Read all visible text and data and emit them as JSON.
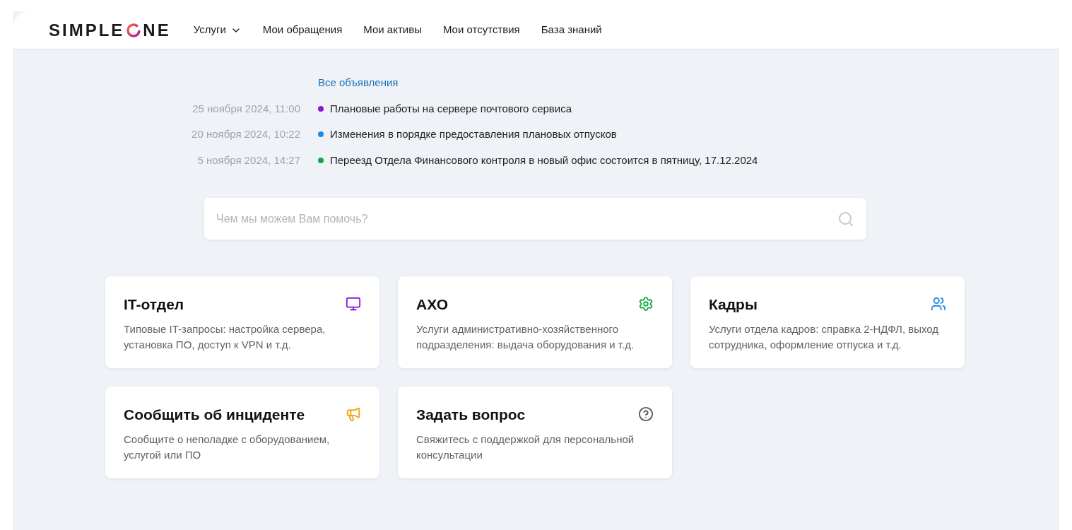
{
  "logo": {
    "left": "SIMPLE",
    "right": "NE"
  },
  "nav": [
    {
      "label": "Услуги",
      "dropdown": true
    },
    {
      "label": "Мои обращения",
      "dropdown": false
    },
    {
      "label": "Мои активы",
      "dropdown": false
    },
    {
      "label": "Мои отсутствия",
      "dropdown": false
    },
    {
      "label": "База знаний",
      "dropdown": false
    }
  ],
  "announcements": {
    "all_link": "Все объявления",
    "items": [
      {
        "date": "25 ноября 2024, 11:00",
        "title": "Плановые работы на сервере почтового сервиса",
        "color": "#8a16d8"
      },
      {
        "date": "20 ноября 2024, 10:22",
        "title": "Изменения в порядке предоставления плановых отпусков",
        "color": "#1e88e5"
      },
      {
        "date": "5 ноября 2024, 14:27",
        "title": "Переезд Отдела Финансового контроля в новый офис состоится в пятницу, 17.12.2024",
        "color": "#12a84a"
      }
    ]
  },
  "search": {
    "placeholder": "Чем мы можем Вам помочь?"
  },
  "cards": [
    {
      "title": "IT-отдел",
      "description": "Типовые IT-запросы: настройка сервера, установка ПО, доступ к VPN и т.д.",
      "kind": "monitor",
      "color": "#8a16d8"
    },
    {
      "title": "АХО",
      "description": "Услуги административно-хозяйственного подразделения: выдача оборудования и т.д.",
      "kind": "gear",
      "color": "#12a84a"
    },
    {
      "title": "Кадры",
      "description": "Услуги отдела кадров: справка 2-НДФЛ, выход сотрудника, оформление отпуска и т.д.",
      "kind": "users",
      "color": "#1e88e5"
    },
    {
      "title": "Сообщить об инциденте",
      "description": "Сообщите о неполадке с оборудованием, услугой или ПО",
      "kind": "megaphone",
      "color": "#f59e0b"
    },
    {
      "title": "Задать вопрос",
      "description": "Свяжитесь с поддержкой для персональной консультации",
      "kind": "help",
      "color": "#555555"
    }
  ]
}
